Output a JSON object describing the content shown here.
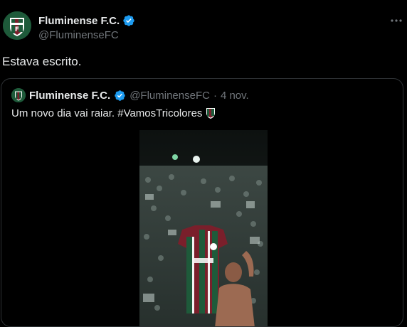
{
  "tweet": {
    "author_name": "Fluminense F.C.",
    "author_handle": "@FluminenseFC",
    "text": "Estava escrito.",
    "more_icon": "more-horizontal-icon"
  },
  "quoted_tweet": {
    "author_name": "Fluminense F.C.",
    "author_handle": "@FluminenseFC",
    "separator": "·",
    "date": "4 nov.",
    "text": "Um novo dia vai raiar. #VamosTricolores",
    "media_icon": "shield-emblem-icon"
  },
  "colors": {
    "background": "#000000",
    "text": "#e7e9ea",
    "secondary_text": "#71767b",
    "verified": "#1d9bf0",
    "border": "#2f3336",
    "club_green": "#1e5a3a",
    "club_maroon": "#7a1f2b"
  }
}
